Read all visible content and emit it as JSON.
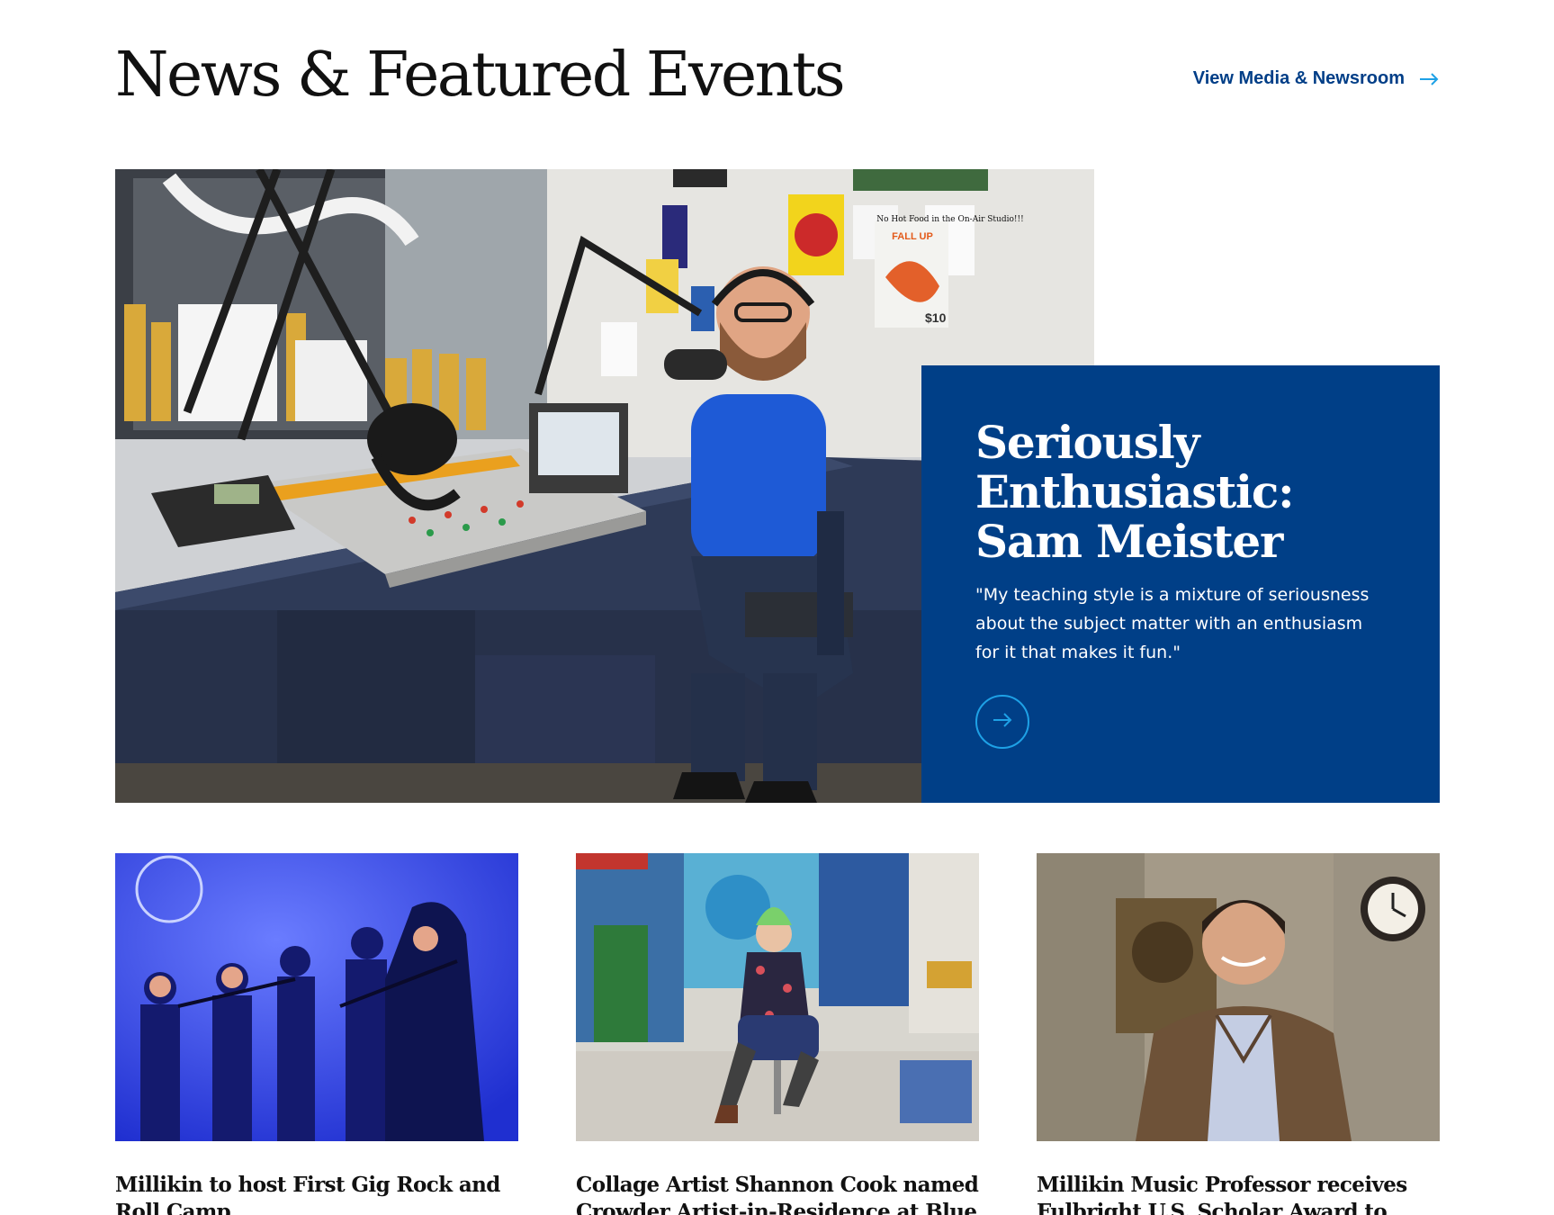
{
  "header": {
    "title": "News & Featured Events",
    "newsroom_link": "View Media & Newsroom"
  },
  "feature": {
    "title": "Seriously Enthusiastic: Sam Meister",
    "quote": "\"My teaching style is a mixture of seriousness about the subject matter with an enthusiasm for it that makes it fun.\"",
    "photo_posters": [
      "No Hot Food in the On-Air Studio!!!",
      "FALL UP",
      "$10"
    ]
  },
  "cards": [
    {
      "title": "Millikin to host First Gig Rock and Roll Camp"
    },
    {
      "title": "Collage Artist Shannon Cook named Crowder Artist-in-Residence at Blue"
    },
    {
      "title": "Millikin Music Professor receives Fulbright U.S. Scholar Award to Brazil"
    }
  ],
  "colors": {
    "brand_blue": "#003f87",
    "link_blue": "#003e87",
    "accent_cyan": "#1ea1e6"
  },
  "icons": {
    "newsroom_arrow": "arrow-right-icon",
    "feature_arrow": "arrow-right-circle-icon"
  }
}
